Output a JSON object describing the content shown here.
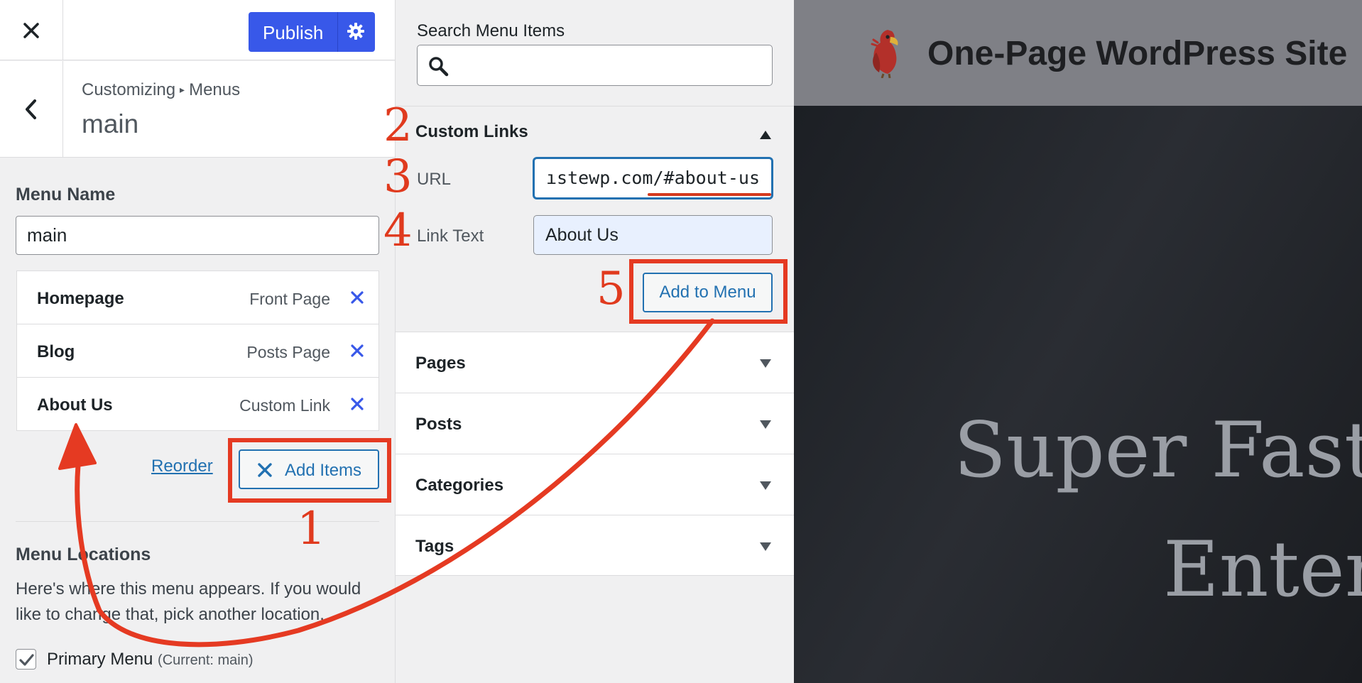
{
  "top_bar": {
    "close_icon": "close-icon",
    "publish_label": "Publish",
    "publish_settings_icon": "gear-icon",
    "publish_color": "#3858e9"
  },
  "panel_header": {
    "back_icon": "chevron-left-icon",
    "breadcrumb_parent": "Customizing",
    "breadcrumb_separator": "▸",
    "breadcrumb_current": "Menus",
    "title": "main"
  },
  "menu_name": {
    "label": "Menu Name",
    "value": "main"
  },
  "menu_items": [
    {
      "title": "Homepage",
      "type": "Front Page"
    },
    {
      "title": "Blog",
      "type": "Posts Page"
    },
    {
      "title": "About Us",
      "type": "Custom Link"
    }
  ],
  "actions": {
    "reorder_label": "Reorder",
    "add_items_label": "Add Items"
  },
  "menu_locations": {
    "title": "Menu Locations",
    "description": "Here's where this menu appears. If you would like to change that, pick another location.",
    "primary_label": "Primary Menu",
    "primary_current": "(Current: main)",
    "primary_checked": true
  },
  "search": {
    "label": "Search Menu Items",
    "value": ""
  },
  "custom_links": {
    "title": "Custom Links",
    "url_label": "URL",
    "url_value": "ıstewp.com/#about-us",
    "link_text_label": "Link Text",
    "link_text_value": "About Us",
    "add_button_label": "Add to Menu"
  },
  "accordions": [
    "Pages",
    "Posts",
    "Categories",
    "Tags"
  ],
  "preview": {
    "site_title": "One-Page WordPress Site",
    "hero_line1": "Super Fast,",
    "hero_line2": "Enter"
  },
  "annotations": {
    "color": "#e53a22",
    "steps": [
      "1",
      "2",
      "3",
      "4",
      "5"
    ]
  }
}
